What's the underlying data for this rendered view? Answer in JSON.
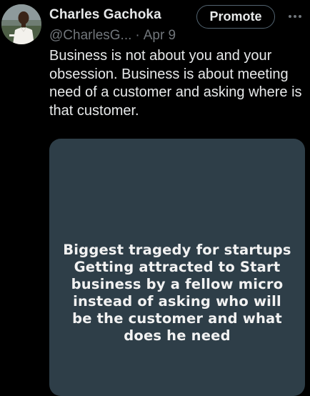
{
  "tweet": {
    "author_name": "Charles Gachoka",
    "handle": "@CharlesG...",
    "separator": "·",
    "date": "Apr 9",
    "promote_label": "Promote",
    "more_icon": "more-horizontal-icon",
    "text": "Business is not about you and your obsession. Business is about meeting need of a customer and asking where is that customer.",
    "media": {
      "background_color": "#2e3e48",
      "lines": [
        "Biggest tragedy for startups",
        "Getting attracted to Start",
        "business by a fellow micro",
        "instead of asking who will",
        "be the customer and what",
        "does he need"
      ]
    }
  },
  "colors": {
    "background": "#000000",
    "primary_text": "#e7e9ea",
    "secondary_text": "#71767b",
    "button_border": "#536471"
  }
}
